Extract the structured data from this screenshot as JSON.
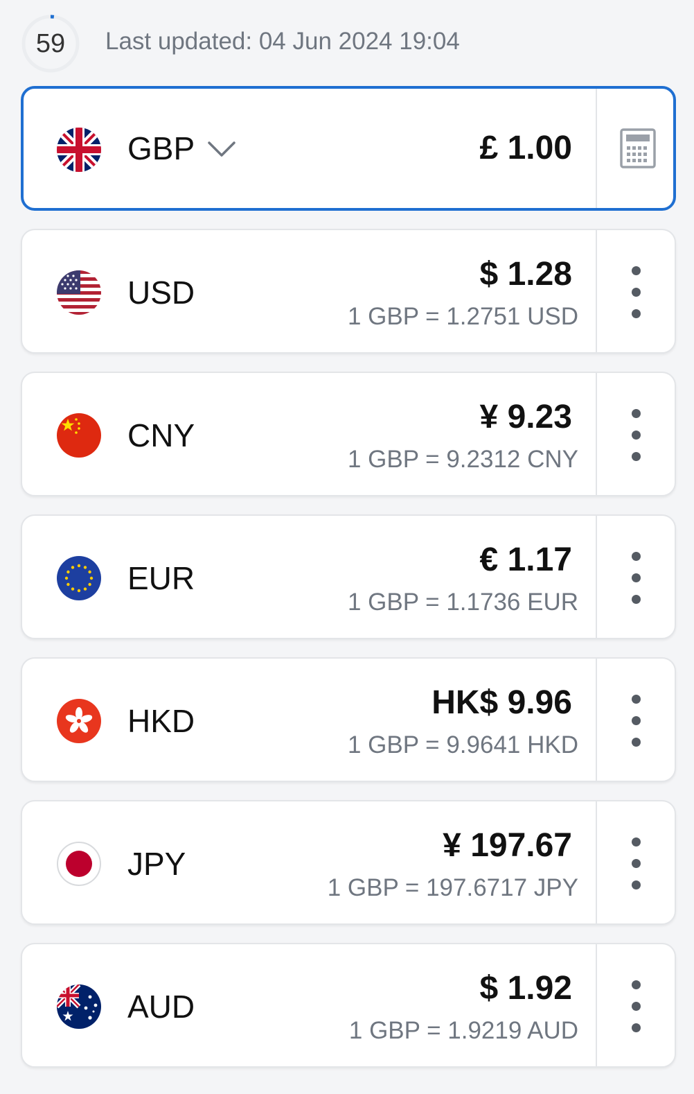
{
  "header": {
    "refresh_countdown": "59",
    "refresh_progress": 0.02,
    "last_updated": "Last updated: 04 Jun 2024 19:04"
  },
  "base": {
    "code": "GBP",
    "amount": "£ 1.00",
    "flag_icon": "uk-flag-icon",
    "dropdown_icon": "chevron-down-icon",
    "action_icon": "calculator-icon"
  },
  "currencies": [
    {
      "code": "USD",
      "amount": "$ 1.28",
      "rate": "1 GBP = 1.2751 USD",
      "flag_icon": "us-flag-icon"
    },
    {
      "code": "CNY",
      "amount": "¥ 9.23",
      "rate": "1 GBP = 9.2312 CNY",
      "flag_icon": "china-flag-icon"
    },
    {
      "code": "EUR",
      "amount": "€ 1.17",
      "rate": "1 GBP = 1.1736 EUR",
      "flag_icon": "eu-flag-icon"
    },
    {
      "code": "HKD",
      "amount": "HK$ 9.96",
      "rate": "1 GBP = 9.9641 HKD",
      "flag_icon": "hong-kong-flag-icon"
    },
    {
      "code": "JPY",
      "amount": "¥ 197.67",
      "rate": "1 GBP = 197.6717 JPY",
      "flag_icon": "japan-flag-icon"
    },
    {
      "code": "AUD",
      "amount": "$ 1.92",
      "rate": "1 GBP = 1.9219 AUD",
      "flag_icon": "australia-flag-icon"
    }
  ],
  "colors": {
    "accent": "#1f6fd1",
    "card_border": "#e3e5e8",
    "secondary_text": "#6f7680",
    "background": "#f4f5f7"
  }
}
